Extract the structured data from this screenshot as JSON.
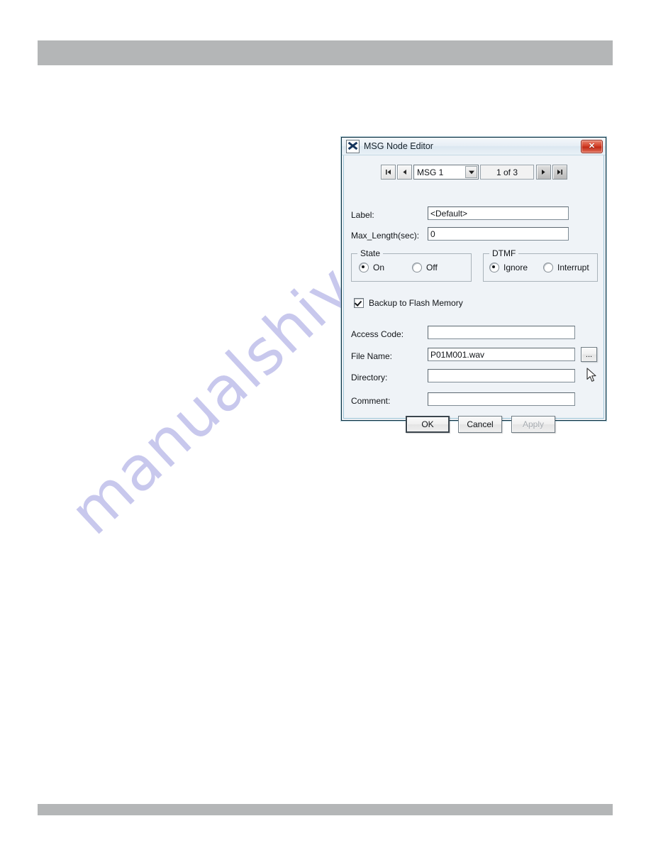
{
  "page": {
    "header_band": "",
    "footer_band": "",
    "watermark": "manualshive.com",
    "watermark_color": "#b9b9e8"
  },
  "dialog": {
    "title": "MSG Node Editor",
    "icon": "app-icon",
    "close_label": "✕",
    "nav": {
      "first_label": "|◀",
      "prev_label": "◀",
      "selected_node": "MSG 1",
      "dropdown_arrow": "▼",
      "counter": "1 of 3",
      "next_label": "▶",
      "last_label": "▶|"
    },
    "fields": {
      "label_caption": "Label:",
      "label_value": "<Default>",
      "max_length_caption": "Max_Length(sec):",
      "max_length_value": "0",
      "access_code_caption": "Access Code:",
      "access_code_value": "",
      "file_name_caption": "File Name:",
      "file_name_value": "P01M001.wav",
      "browse_label": "...",
      "directory_caption": "Directory:",
      "directory_value": "",
      "comment_caption": "Comment:",
      "comment_value": ""
    },
    "state_group": {
      "title": "State",
      "options": [
        {
          "label": "On",
          "checked": true
        },
        {
          "label": "Off",
          "checked": false
        }
      ]
    },
    "dtmf_group": {
      "title": "DTMF",
      "options": [
        {
          "label": "Ignore",
          "checked": true
        },
        {
          "label": "Interrupt",
          "checked": false
        }
      ]
    },
    "backup_checkbox": {
      "label": "Backup to Flash Memory",
      "checked": true
    },
    "buttons": {
      "ok": "OK",
      "cancel": "Cancel",
      "apply": "Apply",
      "apply_disabled": true
    }
  }
}
